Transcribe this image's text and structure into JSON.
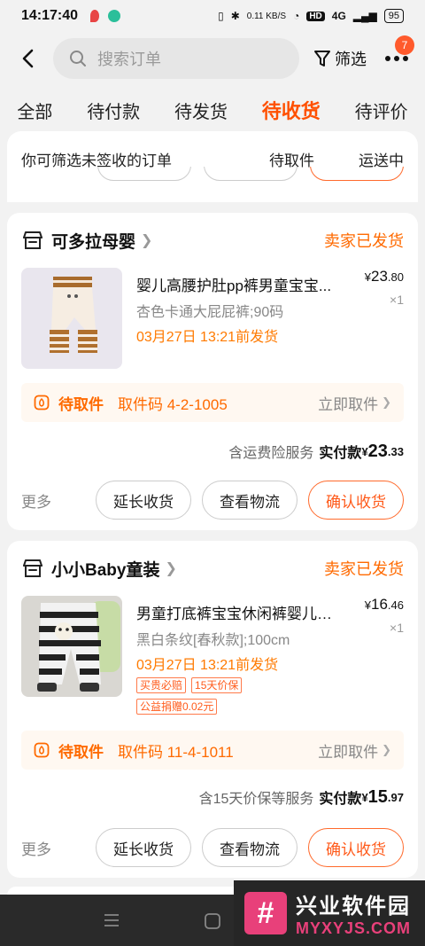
{
  "status_bar": {
    "time": "14:17:40",
    "network_speed": "0.11 KB/S",
    "hd": "HD",
    "signal": "4G",
    "battery": "95"
  },
  "top_bar": {
    "search_placeholder": "搜索订单",
    "filter_label": "筛选",
    "more_badge": "7"
  },
  "tabs": [
    {
      "label": "全部",
      "active": false
    },
    {
      "label": "待付款",
      "active": false
    },
    {
      "label": "待发货",
      "active": false
    },
    {
      "label": "待收货",
      "active": true
    },
    {
      "label": "待评价",
      "active": false
    }
  ],
  "filter_panel": {
    "hint": "你可筛选未签收的订单",
    "chips": [
      "待取件",
      "运送中"
    ]
  },
  "orders": [
    {
      "shop_name": "可多拉母婴",
      "status": "卖家已发货",
      "product_title": "婴儿高腰护肚pp裤男童宝宝...",
      "sku": "杏色卡通大屁屁裤;90码",
      "ship_time": "03月27日 13:21前发货",
      "price_symbol": "¥",
      "price_int": "23",
      "price_dec": ".80",
      "qty": "×1",
      "tags": [],
      "extra_tag": "",
      "pickup_label": "待取件",
      "pickup_code": "取件码 4-2-1005",
      "pickup_action": "立即取件",
      "service_note": "含运费险服务",
      "paid_label": "实付款",
      "paid_symbol": "¥",
      "paid_int": "23",
      "paid_dec": ".33",
      "more": "更多",
      "btn_extend": "延长收货",
      "btn_logistics": "查看物流",
      "btn_confirm": "确认收货"
    },
    {
      "shop_name": "小小Baby童装",
      "status": "卖家已发货",
      "product_title": "男童打底裤宝宝休闲裤婴儿童...",
      "sku": "黑白条纹[春秋款];100cm",
      "ship_time": "03月27日 13:21前发货",
      "price_symbol": "¥",
      "price_int": "16",
      "price_dec": ".46",
      "qty": "×1",
      "tags": [
        "买贵必赔",
        "15天价保"
      ],
      "extra_tag": "公益捐赠0.02元",
      "pickup_label": "待取件",
      "pickup_code": "取件码 11-4-1011",
      "pickup_action": "立即取件",
      "service_note": "含15天价保等服务",
      "paid_label": "实付款",
      "paid_symbol": "¥",
      "paid_int": "15",
      "paid_dec": ".97",
      "more": "更多",
      "btn_extend": "延长收货",
      "btn_logistics": "查看物流",
      "btn_confirm": "确认收货"
    }
  ],
  "watermark": {
    "logo_char": "#",
    "name": "兴业软件园",
    "url": "MYXYJS.COM"
  },
  "colors": {
    "accent": "#ff5000",
    "status_orange": "#ff6a00",
    "page_bg": "#f2f2f2"
  }
}
